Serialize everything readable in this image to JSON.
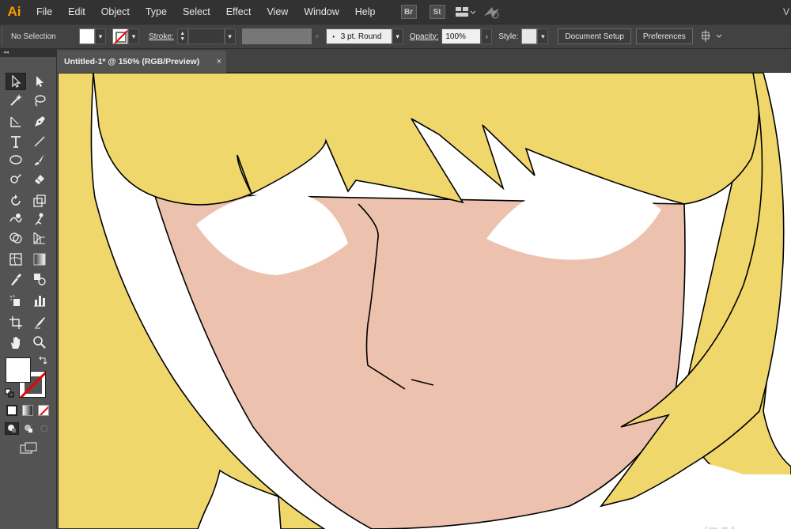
{
  "app": {
    "logo": "Ai"
  },
  "menu": [
    "File",
    "Edit",
    "Object",
    "Type",
    "Select",
    "Effect",
    "View",
    "Window",
    "Help"
  ],
  "app_buttons": {
    "bridge": "Br",
    "stock": "St"
  },
  "menu_right": "V",
  "control_bar": {
    "selection_status": "No Selection",
    "stroke_label": "Stroke:",
    "profile": "3 pt. Round",
    "opacity_label": "Opacity:",
    "opacity_value": "100%",
    "style_label": "Style:",
    "document_setup": "Document Setup",
    "preferences": "Preferences"
  },
  "document_tab": {
    "title": "Untitled-1* @ 150% (RGB/Preview)",
    "close": "×"
  },
  "toolbox": {
    "header": "◂◂"
  },
  "colors": {
    "hair": "#F0D76C",
    "skin": "#ECC2AF",
    "eye": "#FFFFFF",
    "outline": "#000000",
    "menubar": "#323232",
    "panel": "#535353",
    "logo": "#FF9A00"
  },
  "icons": [
    "selection-tool",
    "direct-selection-tool",
    "magic-wand-tool",
    "lasso-tool",
    "pen-tool",
    "type-tool",
    "line-segment-tool",
    "ellipse-tool",
    "paintbrush-tool",
    "pencil-tool",
    "eraser-tool",
    "rotate-tool",
    "scale-tool",
    "warp-tool",
    "free-transform-tool",
    "shape-builder-tool",
    "perspective-grid-tool",
    "mesh-tool",
    "gradient-tool",
    "eyedropper-tool",
    "blend-tool",
    "symbol-sprayer-tool",
    "column-graph-tool",
    "artboard-tool",
    "slice-tool",
    "hand-tool",
    "zoom-tool"
  ],
  "watermark": "Bai 经验"
}
